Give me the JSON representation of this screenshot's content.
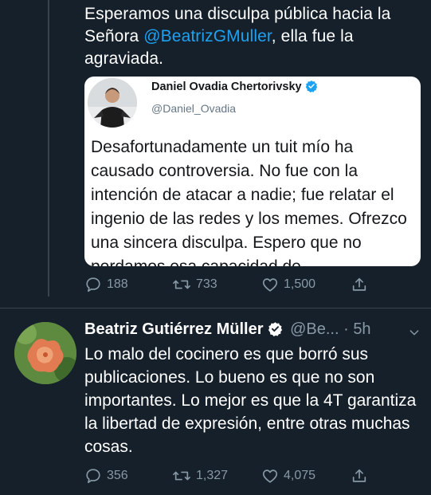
{
  "colors": {
    "background": "#15202b",
    "text": "#ffffff",
    "muted": "#8899a6",
    "link": "#1da1f2",
    "verified": "#1da1f2",
    "card": "#ffffff"
  },
  "tweet1": {
    "text_before": "Esperamos una disculpa pública hacia la Señora ",
    "mention": "@BeatrizGMuller",
    "text_after": ", ella fue la agraviada.",
    "quote": {
      "name": "Daniel Ovadia Chertorivsky",
      "handle": "@Daniel_Ovadia",
      "text": "Desafortunadamente un tuit mío ha causado controversia. No fue con la intención de atacar a nadie; fue relatar el ingenio de las redes y los memes. Ofrezco una sincera disculpa. Espero que no perdamos esa capacidad de"
    },
    "actions": {
      "replies": "188",
      "retweets": "733",
      "likes": "1,500"
    }
  },
  "tweet2": {
    "name": "Beatriz Gutiérrez Müller",
    "handle": "@Be...",
    "dot": "·",
    "time": "5h",
    "text": "Lo malo del cocinero es que borró sus publicaciones. Lo bueno es que no son importantes. Lo mejor es que la 4T garantiza la libertad de expresión, entre otras muchas cosas.",
    "actions": {
      "replies": "356",
      "retweets": "1,327",
      "likes": "4,075"
    }
  },
  "icons": [
    "reply-icon",
    "retweet-icon",
    "like-icon",
    "share-icon",
    "verified-icon",
    "chevron-down-icon"
  ]
}
